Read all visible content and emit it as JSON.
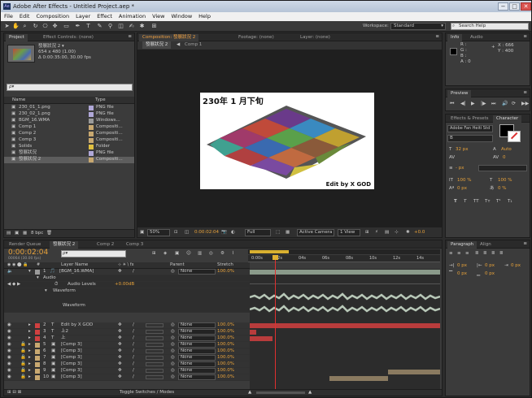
{
  "window": {
    "title": "Adobe After Effects - Untitled Project.aep *",
    "logo": "Ae",
    "min": "−",
    "max": "□",
    "close": "✕"
  },
  "menu": [
    "File",
    "Edit",
    "Composition",
    "Layer",
    "Effect",
    "Animation",
    "View",
    "Window",
    "Help"
  ],
  "toolbar": {
    "workspace_label": "Workspace:",
    "workspace_value": "Standard",
    "search_placeholder": "Search Help"
  },
  "project_panel": {
    "tabs": [
      "Project",
      "Effect Controls: (none)"
    ],
    "comp_name": "發展狀況 2 ▾",
    "comp_size": "654 x 480 (1.00)",
    "comp_dur": "Δ 0:00:35:00, 30.00 fps",
    "search_placeholder": "ρ▾",
    "col_name": "Name",
    "col_type": "Type",
    "items": [
      {
        "name": "230_01_1.png",
        "type": "PNG file",
        "color": "#b0a8d8",
        "icon": "image-icon"
      },
      {
        "name": "230_02_1.png",
        "type": "PNG file",
        "color": "#b0a8d8",
        "icon": "image-icon"
      },
      {
        "name": "BGM_16.WMA",
        "type": "Windows...",
        "color": "#9a9a9a",
        "icon": "audio-icon"
      },
      {
        "name": "Comp 1",
        "type": "Compositi...",
        "color": "#c8a870",
        "icon": "comp-icon"
      },
      {
        "name": "Comp 2",
        "type": "Compositi...",
        "color": "#c8a870",
        "icon": "comp-icon"
      },
      {
        "name": "Comp 3",
        "type": "Compositi...",
        "color": "#c8a870",
        "icon": "comp-icon"
      },
      {
        "name": "Solids",
        "type": "Folder",
        "color": "#e0c040",
        "icon": "folder-icon"
      },
      {
        "name": "發展狀況",
        "type": "PNG file",
        "color": "#b0a8d8",
        "icon": "image-icon"
      },
      {
        "name": "發展狀況 2",
        "type": "Compositi...",
        "color": "#c8a870",
        "icon": "comp-icon"
      }
    ],
    "bpc": "8 bpc"
  },
  "viewer": {
    "tabs": [
      "Composition: 發展狀況 2",
      "Footage: (none)",
      "Layer: (none)"
    ],
    "comp_tabs": [
      "發展狀況 2",
      "Comp 1"
    ],
    "frame_title": "230年 1 月下旬",
    "watermark": "Edit by X GOD",
    "zoom": "50%",
    "timecode": "0:00:02:04",
    "resolution": "Full",
    "camera": "Active Camera",
    "views": "1 View",
    "exposure": "+0.0"
  },
  "info_panel": {
    "tabs": [
      "Info",
      "Audio"
    ],
    "r": "R :",
    "g": "G :",
    "b": "B :",
    "a": "A : 0",
    "x": "X : 666",
    "y": "Y : 400"
  },
  "preview_panel": {
    "tab": "Preview"
  },
  "effects_panel": {
    "tab": "Effects & Presets"
  },
  "character_panel": {
    "tab": "Character",
    "font": "Adobe Fan Heiti Std",
    "style": "B",
    "size": "32 px",
    "leading": "Auto",
    "tracking": "0",
    "stroke": "- px",
    "vscale": "100 %",
    "hscale": "100 %",
    "baseline": "0 px",
    "tsume": "0 %"
  },
  "timeline": {
    "tabs": [
      "Render Queue",
      "發展狀況 2",
      "Comp 2",
      "Comp 3"
    ],
    "timecode": "0:00:02:04",
    "frame": "00064 (30.00 fps)",
    "col_layer": "Layer Name",
    "col_parent": "Parent",
    "col_stretch": "Stretch",
    "ruler": [
      "0:00s",
      "02s",
      "04s",
      "06s",
      "08s",
      "10s",
      "12s",
      "14s"
    ],
    "audio_label": "Audio",
    "audio_levels_label": "Audio Levels",
    "audio_levels_value": "+0.00dB",
    "waveform_label": "Waveform",
    "waveform_sub": "Waveform",
    "toggle": "Toggle Switches / Modes",
    "layers": [
      {
        "num": "1",
        "name": "[BGM_16.WMA]",
        "color": "#9a9a9a",
        "parent": "None",
        "stretch": "100.0%"
      },
      {
        "num": "2",
        "name": "Edit by X GOD",
        "color": "#d04040",
        "parent": "None",
        "stretch": "100.0%"
      },
      {
        "num": "3",
        "name": "上2",
        "color": "#d04040",
        "parent": "None",
        "stretch": "100.0%"
      },
      {
        "num": "4",
        "name": "上",
        "color": "#d04040",
        "parent": "None",
        "stretch": "100.0%"
      },
      {
        "num": "5",
        "name": "[Comp 3]",
        "color": "#c8a870",
        "parent": "None",
        "stretch": "100.0%"
      },
      {
        "num": "6",
        "name": "[Comp 3]",
        "color": "#c8a870",
        "parent": "None",
        "stretch": "100.0%"
      },
      {
        "num": "7",
        "name": "[Comp 3]",
        "color": "#c8a870",
        "parent": "None",
        "stretch": "100.0%"
      },
      {
        "num": "8",
        "name": "[Comp 3]",
        "color": "#c8a870",
        "parent": "None",
        "stretch": "100.0%"
      },
      {
        "num": "9",
        "name": "[Comp 3]",
        "color": "#c8a870",
        "parent": "None",
        "stretch": "100.0%"
      },
      {
        "num": "10",
        "name": "[Comp 3]",
        "color": "#c8a870",
        "parent": "None",
        "stretch": "100.0%"
      }
    ]
  },
  "paragraph_panel": {
    "tabs": [
      "Paragraph",
      "Align"
    ],
    "indent_left": "0 px",
    "indent_right": "0 px",
    "indent_first": "0 px",
    "space_before": "0 px",
    "space_after": "0 px"
  }
}
